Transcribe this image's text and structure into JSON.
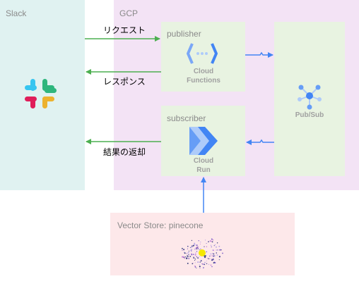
{
  "groups": {
    "slack": {
      "label": "Slack"
    },
    "gcp": {
      "label": "GCP"
    },
    "vector_store": {
      "label": "Vector Store: pinecone"
    }
  },
  "boxes": {
    "publisher": {
      "label": "publisher",
      "service": [
        "Cloud",
        "Functions"
      ]
    },
    "subscriber": {
      "label": "subscriber",
      "service": [
        "Cloud",
        "Run"
      ]
    },
    "pubsub": {
      "service": "Pub/Sub"
    }
  },
  "arrows": {
    "request": "リクエスト",
    "response": "レスポンス",
    "result": "結果の返却"
  },
  "icons": [
    "slack-logo-icon",
    "cloud-functions-icon",
    "cloud-run-icon",
    "pubsub-icon",
    "pinecone-logo-icon"
  ],
  "colors": {
    "slack_bg": "#e0f2f1",
    "gcp_bg": "#f3e3f5",
    "box_bg": "#e8f3e1",
    "vector_bg": "#fde8ea",
    "green_arrow": "#4caf50",
    "blue_arrow": "#4285f4"
  }
}
